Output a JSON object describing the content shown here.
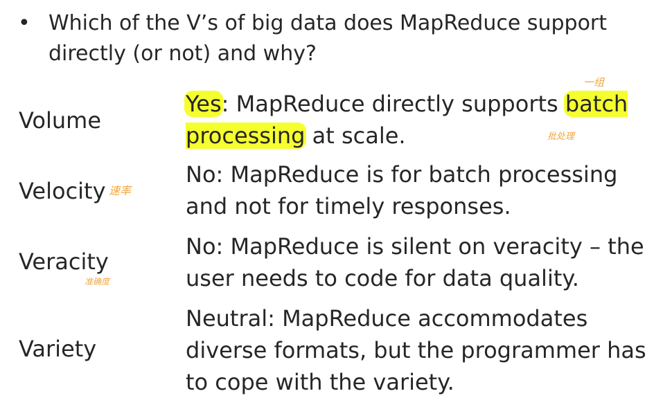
{
  "bullet": "•",
  "question": "Which of the V’s of big data does MapReduce support directly (or not) and why?",
  "rows": [
    {
      "label": "Volume",
      "highlight1": "Yes",
      "text1": ": MapReduce directly supports ",
      "highlight2": "batch processing",
      "text2": " at scale."
    },
    {
      "label": "Velocity",
      "text": "No: MapReduce is for batch processing and not for timely responses."
    },
    {
      "label": "Veracity",
      "text": "No: MapReduce is silent on veracity – the user needs to code for data quality."
    },
    {
      "label": "Variety",
      "text": "Neutral: MapReduce accommodates diverse formats, but the programmer has to cope with the variety."
    }
  ],
  "annotations": {
    "batch_top": "一组",
    "batch_bottom": "批处理",
    "velocity": "速率",
    "veracity": "准确度"
  },
  "colors": {
    "text": "#262626",
    "highlight": "#f6ff2e",
    "annotation": "#f2a640"
  }
}
